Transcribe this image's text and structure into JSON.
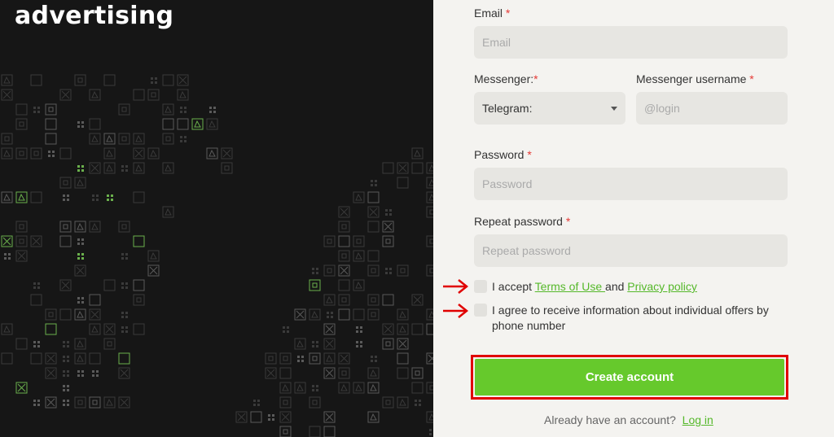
{
  "brand": "advertising",
  "form": {
    "email_label": "Email",
    "email_placeholder": "Email",
    "messenger_label": "Messenger:",
    "messenger_value": "Telegram:",
    "username_label": "Messenger username",
    "username_placeholder": "@login",
    "password_label": "Password",
    "password_placeholder": "Password",
    "repeat_label": "Repeat password",
    "repeat_placeholder": "Repeat password",
    "required_mark": "*",
    "accept_prefix": "I accept ",
    "terms_link": "Terms of Use ",
    "accept_and": "and ",
    "privacy_link": "Privacy policy",
    "agree_text": "I agree to receive information about individual offers by phone number",
    "submit_label": "Create account",
    "have_account": "Already have an account?",
    "login_link": "Log in"
  },
  "colors": {
    "accent": "#66c92c",
    "highlight": "#e00000",
    "left_bg": "#161616"
  }
}
